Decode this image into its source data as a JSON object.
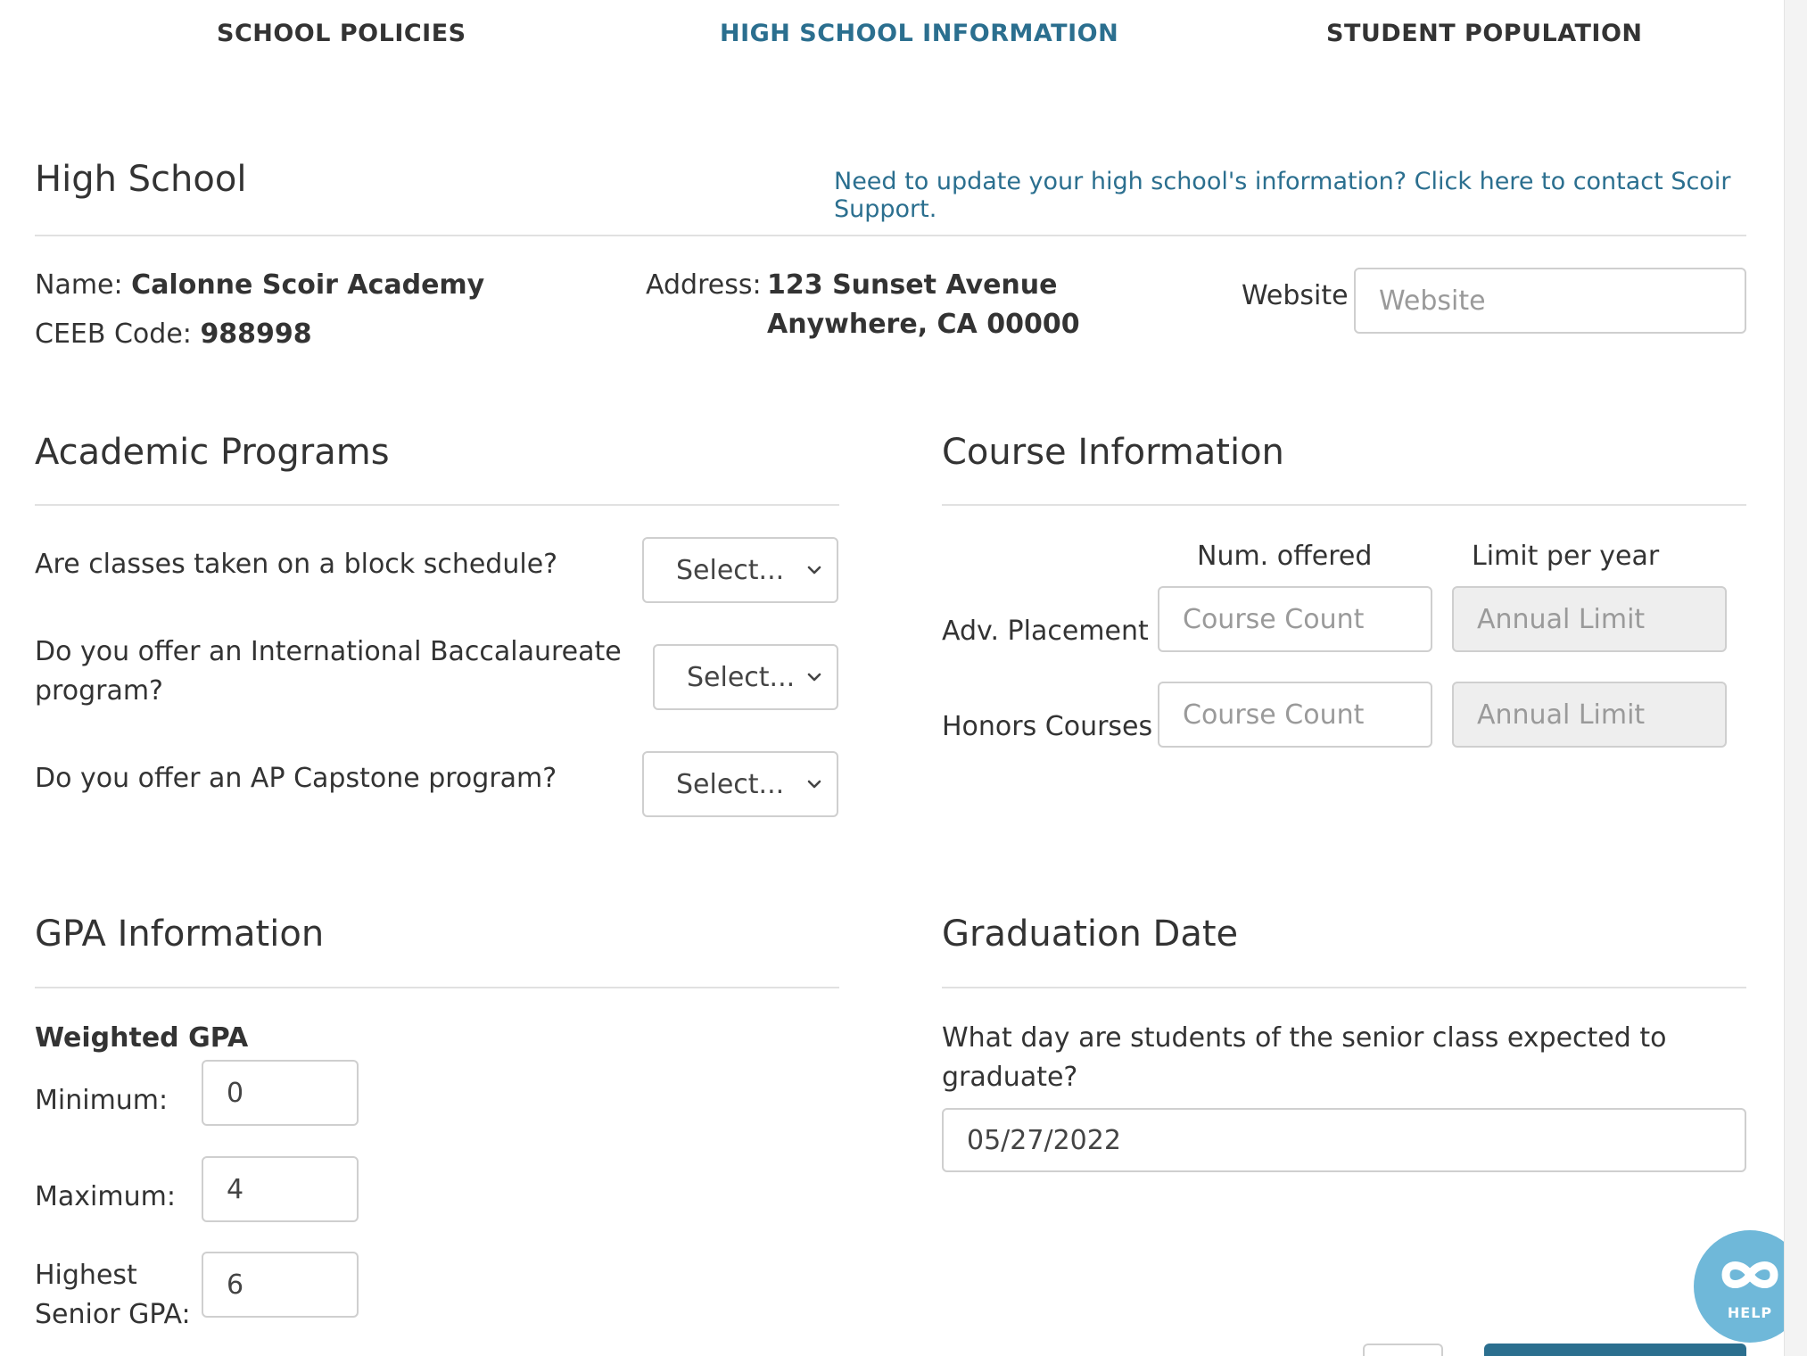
{
  "tabs": [
    {
      "label": "SCHOOL POLICIES",
      "active": false
    },
    {
      "label": "HIGH SCHOOL INFORMATION",
      "active": true
    },
    {
      "label": "STUDENT POPULATION",
      "active": false
    }
  ],
  "high_school": {
    "title": "High School",
    "support_link": "Need to update your high school's information? Click here to contact Scoir Support.",
    "name_label": "Name:",
    "name_value": "Calonne Scoir Academy",
    "ceeb_label": "CEEB Code:",
    "ceeb_value": "988998",
    "address_label": "Address:",
    "address_line1": "123 Sunset Avenue",
    "address_line2": "Anywhere, CA 00000",
    "website_label": "Website",
    "website_placeholder": "Website",
    "website_value": ""
  },
  "academic_programs": {
    "title": "Academic Programs",
    "questions": [
      {
        "label": "Are classes taken on a block schedule?",
        "selected": "Select..."
      },
      {
        "label_line1": "Do you offer an International Baccalaureate",
        "label_line2": "program?",
        "selected": "Select..."
      },
      {
        "label": "Do you offer an AP Capstone program?",
        "selected": "Select..."
      }
    ]
  },
  "course_information": {
    "title": "Course Information",
    "col_offered": "Num. offered",
    "col_limit": "Limit per year",
    "rows": [
      {
        "label": "Adv. Placement",
        "count_placeholder": "Course Count",
        "limit_placeholder": "Annual Limit"
      },
      {
        "label": "Honors Courses",
        "count_placeholder": "Course Count",
        "limit_placeholder": "Annual Limit"
      }
    ]
  },
  "gpa_information": {
    "title": "GPA Information",
    "subtitle": "Weighted GPA",
    "minimum_label": "Minimum:",
    "minimum_value": "0",
    "maximum_label": "Maximum:",
    "maximum_value": "4",
    "highest_label_line1": "Highest",
    "highest_label_line2": "Senior GPA:",
    "highest_value": "6"
  },
  "graduation_date": {
    "title": "Graduation Date",
    "question_line1": "What day are students of the senior class expected to",
    "question_line2": "graduate?",
    "value": "05/27/2022"
  },
  "help": {
    "label": "HELP"
  },
  "colors": {
    "accent": "#2b6f8f",
    "help": "#6fb8d9",
    "border": "#cfcfcf",
    "disabled": "#eeeeee"
  }
}
